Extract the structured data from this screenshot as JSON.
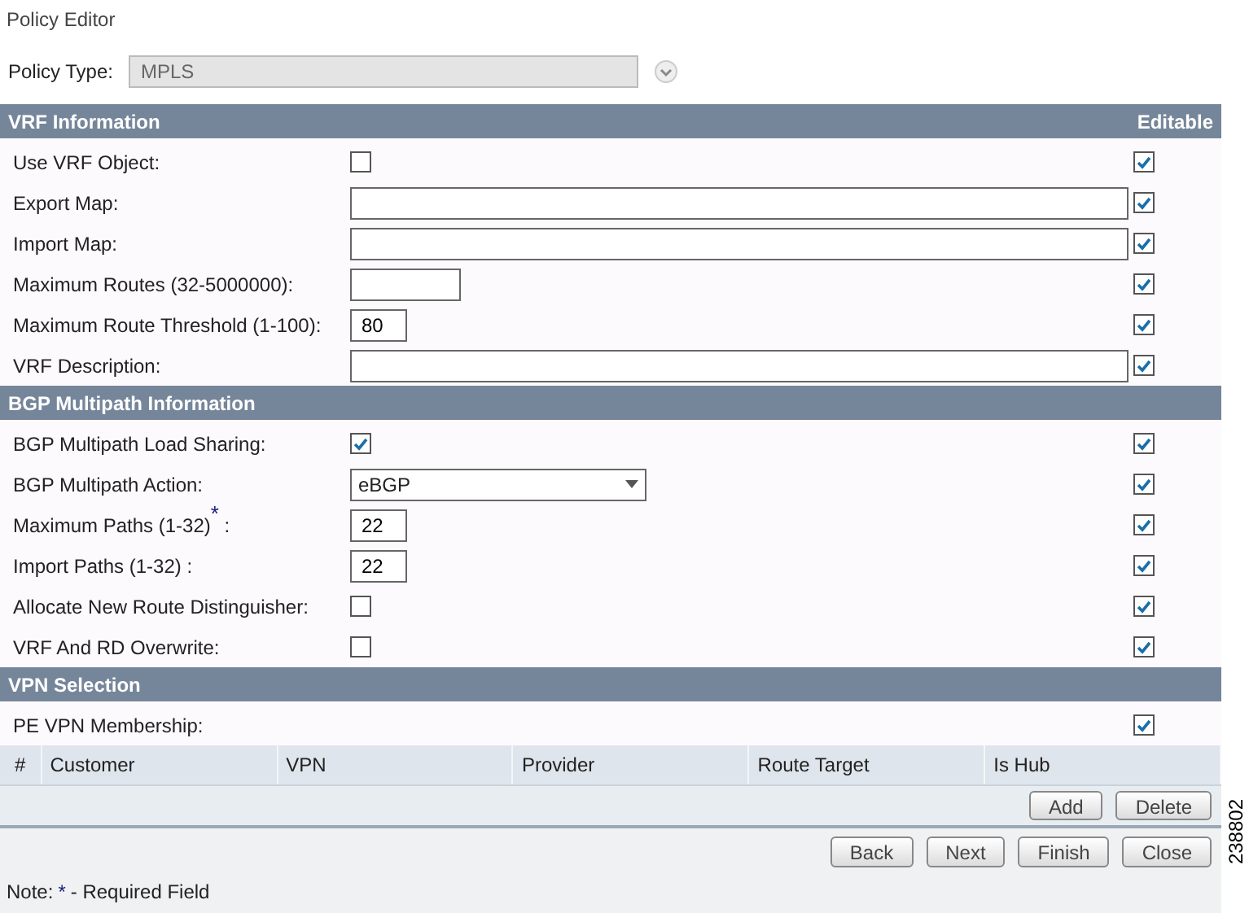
{
  "title": "Policy Editor",
  "policy_type": {
    "label": "Policy Type:",
    "value": "MPLS"
  },
  "sections": [
    {
      "title": "VRF Information",
      "editable_label": "Editable",
      "rows": [
        {
          "label": "Use VRF Object:",
          "kind": "checkbox",
          "checked": false,
          "editable": true
        },
        {
          "label": "Export Map:",
          "kind": "text",
          "value": "",
          "editable": true
        },
        {
          "label": "Import Map:",
          "kind": "text",
          "value": "",
          "editable": true
        },
        {
          "label": "Maximum Routes (32-5000000):",
          "kind": "entry",
          "value": "",
          "editable": true
        },
        {
          "label": "Maximum Route Threshold (1-100):",
          "kind": "number",
          "value": "80",
          "editable": true
        },
        {
          "label": "VRF Description:",
          "kind": "text",
          "value": "",
          "editable": true
        }
      ]
    },
    {
      "title": "BGP Multipath Information",
      "rows": [
        {
          "label": "BGP Multipath Load Sharing:",
          "kind": "checkbox",
          "checked": true,
          "editable": true
        },
        {
          "label": "BGP Multipath Action:",
          "kind": "select",
          "value": "eBGP",
          "editable": true
        },
        {
          "label": "Maximum Paths (1-32)$^{*}$ :",
          "kind": "number",
          "value": "22",
          "editable": true
        },
        {
          "label": "Import Paths (1-32) :",
          "kind": "number",
          "value": "22",
          "editable": true
        },
        {
          "label": "Allocate New Route Distinguisher:",
          "kind": "checkbox",
          "checked": false,
          "editable": true
        },
        {
          "label": "VRF And RD Overwrite:",
          "kind": "checkbox",
          "checked": false,
          "editable": true
        }
      ]
    },
    {
      "title": "VPN Selection",
      "rows": [
        {
          "label": "PE VPN Membership:",
          "kind": "plain",
          "editable": true
        }
      ]
    }
  ],
  "table": {
    "columns": [
      "#",
      "Customer",
      "VPN",
      "Provider",
      "Route Target",
      "Is Hub"
    ],
    "buttons": [
      "Add",
      "Delete"
    ]
  },
  "footer_buttons": [
    "Back",
    "Next",
    "Finish",
    "Close"
  ],
  "note": {
    "prefix": "Note:",
    "mark": "*",
    "text": "- Required Field"
  },
  "figure_number": "238802"
}
